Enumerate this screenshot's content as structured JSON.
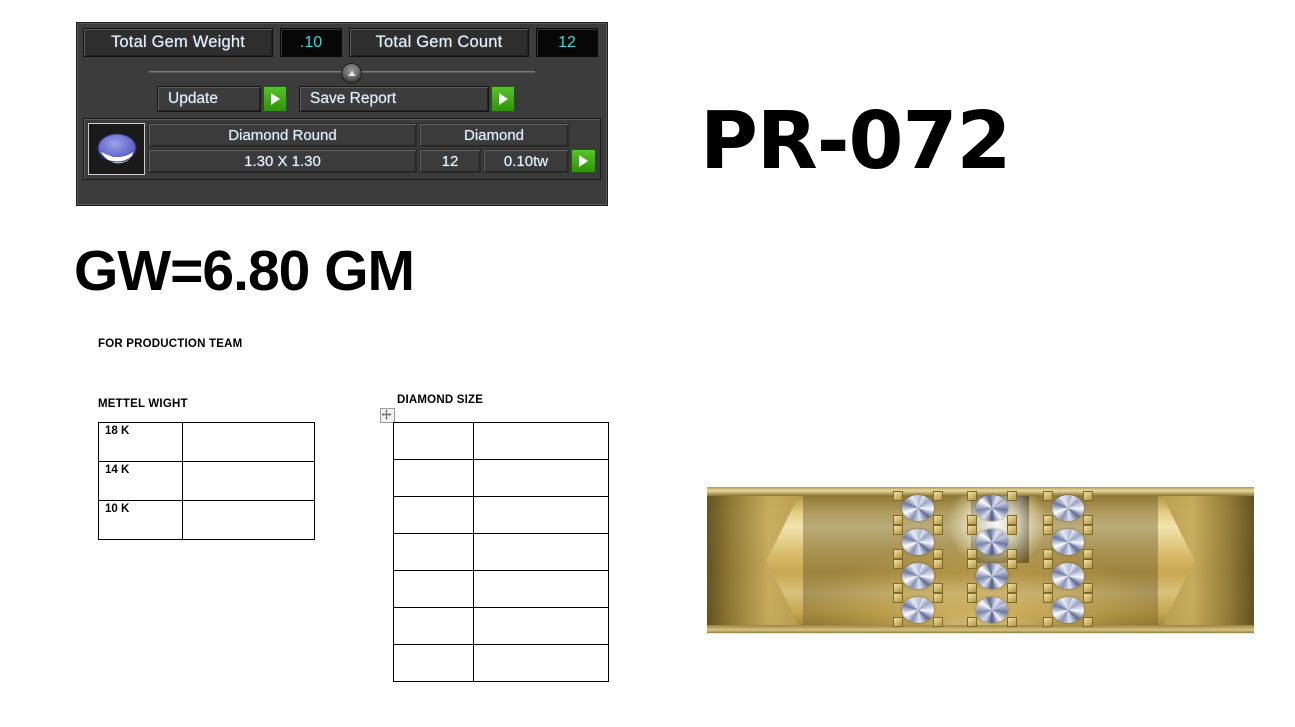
{
  "gem_panel": {
    "total_gem_weight_label": "Total Gem Weight",
    "total_gem_weight_value": ".10",
    "total_gem_count_label": "Total Gem Count",
    "total_gem_count_value": "12",
    "update_button": "Update",
    "save_report_button": "Save Report",
    "table": {
      "headers": {
        "shape": "Diamond Round",
        "type": "Diamond"
      },
      "row": {
        "size": "1.30 X 1.30",
        "qty": "12",
        "weight": "0.10tw"
      }
    },
    "colors": {
      "panel_bg": "#3c3c3c",
      "value_text": "#29dede",
      "value_bg": "#070707",
      "label_text": "#f2f2f2",
      "go_button_green": "#3fab15"
    }
  },
  "headings": {
    "style_code": "PR-072",
    "gross_weight": "GW=6.80 GM"
  },
  "document": {
    "production_heading": "FOR PRODUCTION TEAM",
    "metal_weight_heading": "METTEL WIGHT",
    "diamond_size_heading": "DIAMOND SIZE",
    "metal_table": {
      "rows": [
        {
          "karat": "18 K",
          "value": ""
        },
        {
          "karat": "14 K",
          "value": ""
        },
        {
          "karat": "10 K",
          "value": ""
        }
      ]
    },
    "diamond_table": {
      "rows": [
        {
          "size": "",
          "value": ""
        },
        {
          "size": "",
          "value": ""
        },
        {
          "size": "",
          "value": ""
        },
        {
          "size": "",
          "value": ""
        },
        {
          "size": "",
          "value": ""
        },
        {
          "size": "",
          "value": ""
        },
        {
          "size": "",
          "value": ""
        }
      ]
    }
  },
  "ring_render": {
    "description": "Gold ring band close-up render with three vertical columns of four round diamonds each",
    "stone_columns": 3,
    "stones_per_column": 4,
    "metal_color": "#d9bd6d"
  }
}
